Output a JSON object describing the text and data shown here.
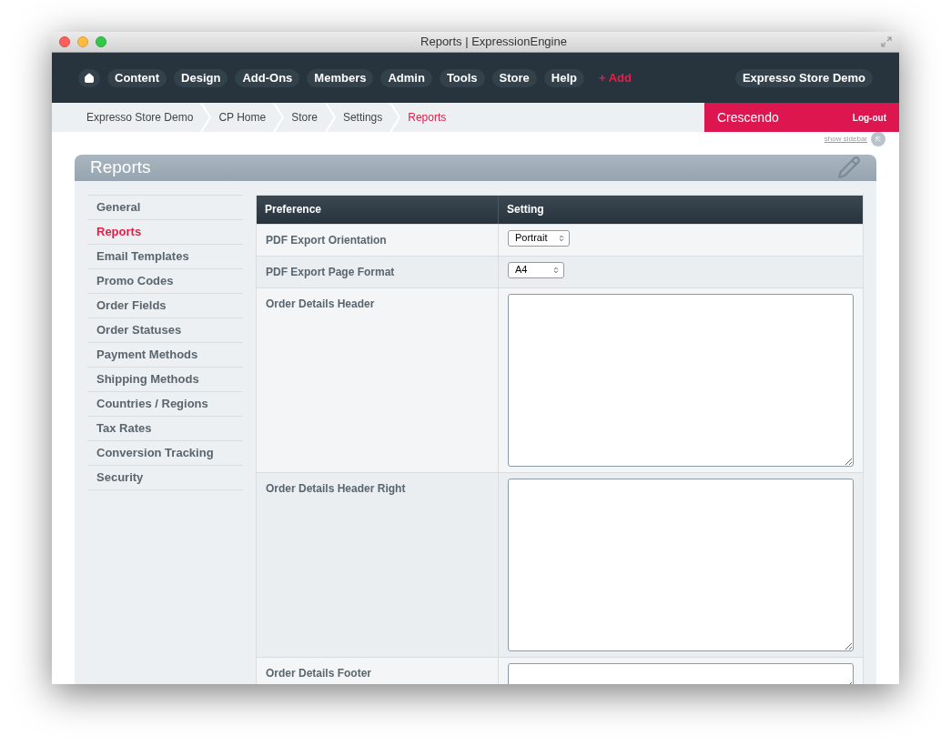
{
  "window": {
    "title": "Reports | ExpressionEngine"
  },
  "nav": {
    "items": [
      {
        "label": "Content"
      },
      {
        "label": "Design"
      },
      {
        "label": "Add-Ons"
      },
      {
        "label": "Members"
      },
      {
        "label": "Admin"
      },
      {
        "label": "Tools"
      },
      {
        "label": "Store"
      },
      {
        "label": "Help"
      }
    ],
    "add": "+ Add",
    "site": "Expresso Store Demo"
  },
  "breadcrumbs": [
    {
      "label": "Expresso Store Demo",
      "selected": false
    },
    {
      "label": "CP Home",
      "selected": false
    },
    {
      "label": "Store",
      "selected": false
    },
    {
      "label": "Settings",
      "selected": false
    },
    {
      "label": "Reports",
      "selected": true
    }
  ],
  "user": {
    "name": "Crescendo",
    "logout": "Log-out"
  },
  "show_sidebar": "show sidebar",
  "panel_title": "Reports",
  "sidebar": {
    "items": [
      {
        "label": "General",
        "selected": false
      },
      {
        "label": "Reports",
        "selected": true
      },
      {
        "label": "Email Templates",
        "selected": false
      },
      {
        "label": "Promo Codes",
        "selected": false
      },
      {
        "label": "Order Fields",
        "selected": false
      },
      {
        "label": "Order Statuses",
        "selected": false
      },
      {
        "label": "Payment Methods",
        "selected": false
      },
      {
        "label": "Shipping Methods",
        "selected": false
      },
      {
        "label": "Countries / Regions",
        "selected": false
      },
      {
        "label": "Tax Rates",
        "selected": false
      },
      {
        "label": "Conversion Tracking",
        "selected": false
      },
      {
        "label": "Security",
        "selected": false
      }
    ]
  },
  "table": {
    "columns": [
      "Preference",
      "Setting"
    ],
    "rows": [
      {
        "label": "PDF Export Orientation",
        "kind": "select",
        "value": "Portrait"
      },
      {
        "label": "PDF Export Page Format",
        "kind": "select",
        "value": "A4"
      },
      {
        "label": "Order Details Header",
        "kind": "textarea"
      },
      {
        "label": "Order Details Header Right",
        "kind": "textarea"
      },
      {
        "label": "Order Details Footer",
        "kind": "textarea"
      }
    ]
  }
}
